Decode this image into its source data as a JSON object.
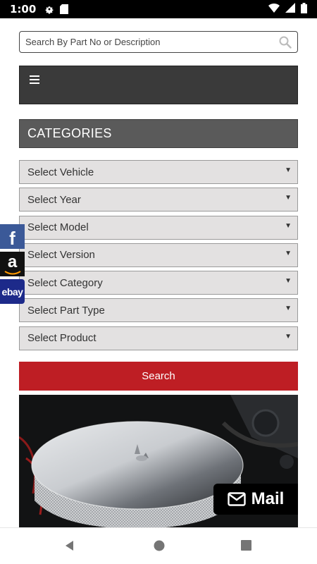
{
  "status_bar": {
    "time": "1:00",
    "icons": [
      "gear-icon",
      "sd-card-icon",
      "wifi-icon",
      "signal-icon",
      "battery-icon"
    ]
  },
  "search": {
    "placeholder": "Search By Part No or Description",
    "value": ""
  },
  "nav": {
    "menu_icon": "hamburger-icon"
  },
  "categories": {
    "header": "CATEGORIES",
    "selects": [
      {
        "label": "Select Vehicle"
      },
      {
        "label": "Select Year"
      },
      {
        "label": "Select Model"
      },
      {
        "label": "Select Version"
      },
      {
        "label": "Select Category"
      },
      {
        "label": "Select Part Type"
      },
      {
        "label": "Select Product"
      }
    ],
    "search_button": "Search"
  },
  "social": {
    "facebook": "f",
    "amazon": "a",
    "ebay": "ebay"
  },
  "mail": {
    "label": "Mail"
  },
  "colors": {
    "accent_red": "#be1e24",
    "nav_dark": "#3a3a3a",
    "category_header": "#5a5a5a",
    "select_bg": "#e3e1e1",
    "facebook_blue": "#3b5998"
  }
}
